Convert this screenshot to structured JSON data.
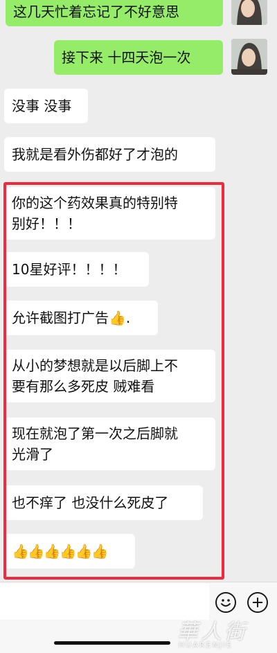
{
  "messages": [
    {
      "side": "out",
      "text": "这几天忙着忘记了不好意思"
    },
    {
      "side": "out",
      "text": "接下来 十四天泡一次"
    },
    {
      "side": "in",
      "text": "没事 没事"
    },
    {
      "side": "in",
      "text": "我就是看外伤都好了才泡的"
    },
    {
      "side": "in",
      "lines": [
        "你的这个药效果真的特别特",
        "别好！！！"
      ]
    },
    {
      "side": "in",
      "text": "10星好评！！！！"
    },
    {
      "side": "in",
      "text": "允许截图打广告",
      "suffix": "."
    },
    {
      "side": "in",
      "lines": [
        "从小的梦想就是以后脚上不",
        "要有那么多死皮 贼难看"
      ]
    },
    {
      "side": "in",
      "lines": [
        "现在就泡了第一次之后脚就",
        "光滑了"
      ]
    },
    {
      "side": "in",
      "text": "也不痒了 也没什么死皮了"
    },
    {
      "side": "in",
      "thumbs_count": 6
    }
  ],
  "icons": {
    "thumbs_up": "thumbs-up-icon",
    "emoji": "emoji-icon",
    "plus": "plus-icon"
  },
  "colors": {
    "outgoing_bubble": "#95ec69",
    "incoming_bubble": "#ffffff",
    "highlight": "#ee2a3c",
    "background": "#ededed"
  },
  "watermark": {
    "title": "華人街",
    "sub": "HUARENJIE"
  }
}
